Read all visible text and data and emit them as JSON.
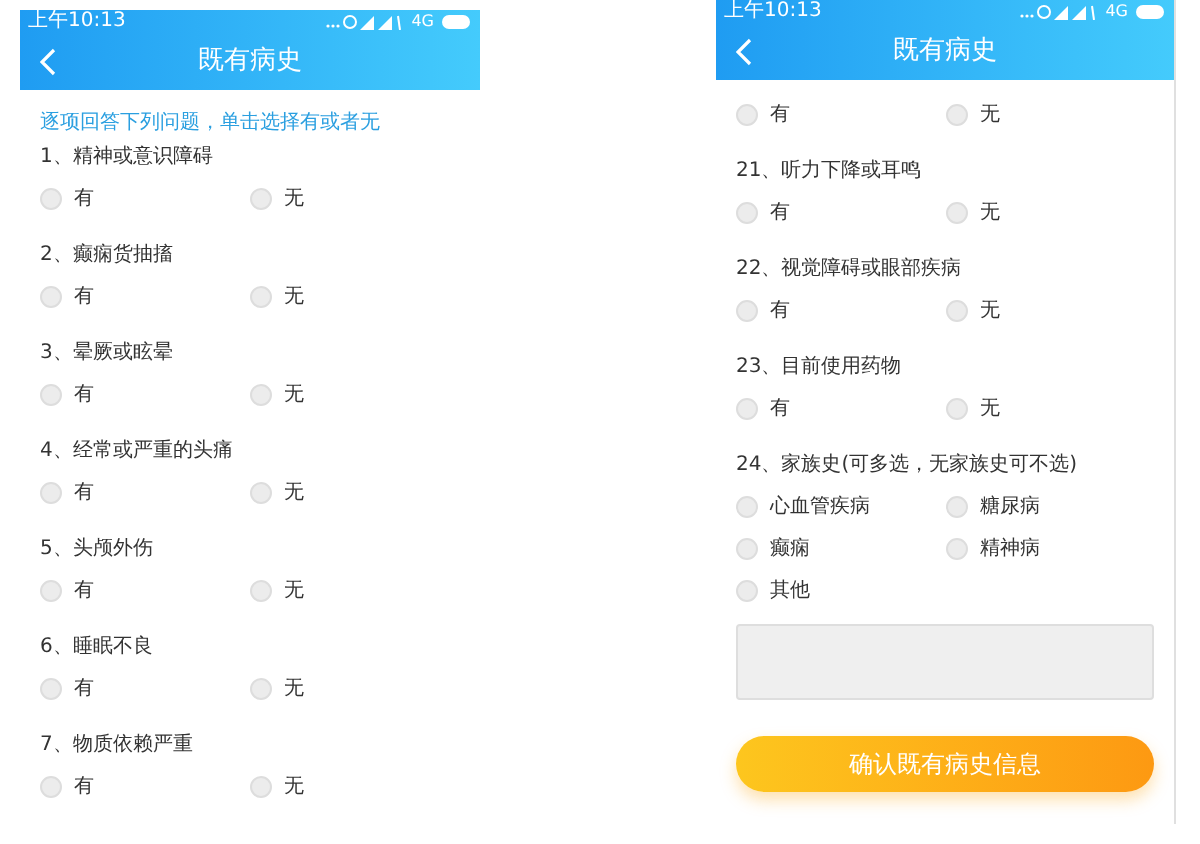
{
  "screens": [
    {
      "status_time": "上午10:13",
      "network": "4G",
      "title": "既有病史",
      "intro": "逐项回答下列问题，单击选择有或者无",
      "questions": [
        {
          "text": "1、精神或意识障碍",
          "options": [
            {
              "label": "有",
              "selected": false
            },
            {
              "label": "无",
              "selected": false
            }
          ]
        },
        {
          "text": "2、癫痫货抽搐",
          "options": [
            {
              "label": "有",
              "selected": false
            },
            {
              "label": "无",
              "selected": false
            }
          ]
        },
        {
          "text": "3、晕厥或眩晕",
          "options": [
            {
              "label": "有",
              "selected": false
            },
            {
              "label": "无",
              "selected": false
            }
          ]
        },
        {
          "text": "4、经常或严重的头痛",
          "options": [
            {
              "label": "有",
              "selected": false
            },
            {
              "label": "无",
              "selected": false
            }
          ]
        },
        {
          "text": "5、头颅外伤",
          "options": [
            {
              "label": "有",
              "selected": false
            },
            {
              "label": "无",
              "selected": false
            }
          ]
        },
        {
          "text": "6、睡眠不良",
          "options": [
            {
              "label": "有",
              "selected": false
            },
            {
              "label": "无",
              "selected": false
            }
          ]
        },
        {
          "text": "7、物质依赖严重",
          "options": [
            {
              "label": "有",
              "selected": false
            },
            {
              "label": "无",
              "selected": false
            }
          ]
        }
      ]
    },
    {
      "status_time": "上午10:13",
      "network": "4G",
      "title": "既有病史",
      "questions": [
        {
          "options": [
            {
              "label": "有",
              "selected": false
            },
            {
              "label": "无",
              "selected": false
            }
          ]
        },
        {
          "text": "21、听力下降或耳鸣",
          "options": [
            {
              "label": "有",
              "selected": false
            },
            {
              "label": "无",
              "selected": false
            }
          ]
        },
        {
          "text": "22、视觉障碍或眼部疾病",
          "options": [
            {
              "label": "有",
              "selected": false
            },
            {
              "label": "无",
              "selected": false
            }
          ]
        },
        {
          "text": "23、目前使用药物",
          "options": [
            {
              "label": "有",
              "selected": false
            },
            {
              "label": "无",
              "selected": false
            }
          ]
        },
        {
          "text": "24、家族史(可多选，无家族史可不选)",
          "options": [
            {
              "label": "心血管疾病",
              "selected": false
            },
            {
              "label": "糖尿病",
              "selected": false
            },
            {
              "label": "癫痫",
              "selected": false
            },
            {
              "label": "精神病",
              "selected": false
            },
            {
              "label": "其他",
              "selected": false
            }
          ]
        }
      ],
      "note_field": {
        "kind": "textarea"
      },
      "confirm_button": "确认既有病史信息"
    }
  ]
}
